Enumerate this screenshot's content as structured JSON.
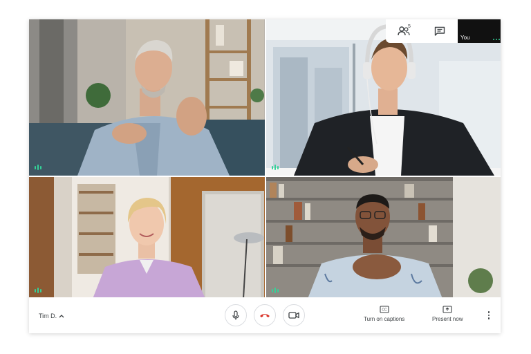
{
  "participants": [
    {
      "id": "p1",
      "speaking": true
    },
    {
      "id": "p2",
      "speaking": true
    },
    {
      "id": "p3",
      "speaking": true
    },
    {
      "id": "p4",
      "speaking": true
    }
  ],
  "top_bar": {
    "participants_count": "5",
    "participants_icon": "people-icon",
    "chat_icon": "chat-icon",
    "self_label": "You"
  },
  "bottom_bar": {
    "user_name": "Tim D.",
    "mic_icon": "mic-icon",
    "hangup_icon": "hangup-icon",
    "camera_icon": "camera-icon",
    "captions_label": "Turn on captions",
    "present_label": "Present now",
    "more_icon": "more-vert-icon"
  },
  "colors": {
    "hangup": "#d93025",
    "speaking_indicator": "#34d399",
    "icon": "#3c4043"
  }
}
